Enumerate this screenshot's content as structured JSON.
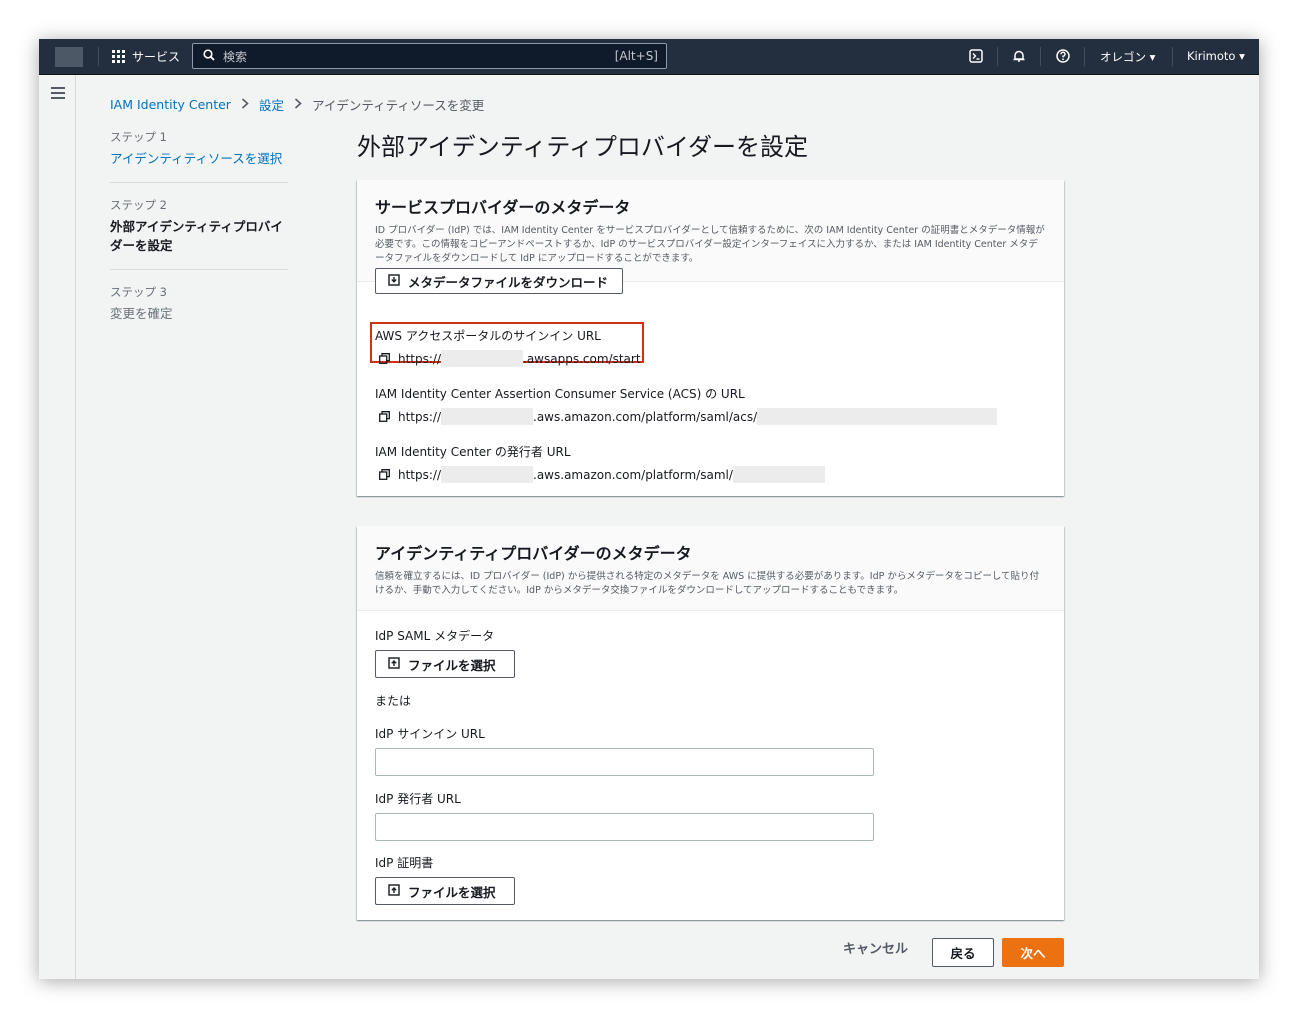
{
  "topnav": {
    "services_label": "サービス",
    "search_placeholder": "検索",
    "search_shortcut": "[Alt+S]",
    "region_label": "オレゴン ▾",
    "user_label": "Kirimoto ▾"
  },
  "breadcrumb": {
    "items": [
      "IAM Identity Center",
      "設定",
      "アイデンティティソースを変更"
    ]
  },
  "steps": [
    {
      "number": "ステップ 1",
      "title": "アイデンティティソースを選択"
    },
    {
      "number": "ステップ 2",
      "title": "外部アイデンティティプロバイダーを設定"
    },
    {
      "number": "ステップ 3",
      "title": "変更を確定"
    }
  ],
  "page_title": "外部アイデンティティプロバイダーを設定",
  "sp_panel": {
    "title": "サービスプロバイダーのメタデータ",
    "description": "ID プロバイダー (IdP) では、IAM Identity Center をサービスプロバイダーとして信頼するために、次の IAM Identity Center の証明書とメタデータ情報が必要です。この情報をコピーアンドペーストするか、IdP のサービスプロバイダー設定インターフェイスに入力するか、または IAM Identity Center メタデータファイルをダウンロードして IdP にアップロードすることができます。",
    "download_button": "メタデータファイルをダウンロード",
    "portal_label": "AWS アクセスポータルのサインイン URL",
    "portal_url_prefix": "https://",
    "portal_url_suffix": ".awsapps.com/start",
    "acs_label": "IAM Identity Center Assertion Consumer Service (ACS) の URL",
    "acs_url_prefix": "https://",
    "acs_url_middle": ".aws.amazon.com/platform/saml/acs/",
    "issuer_label": "IAM Identity Center の発行者 URL",
    "issuer_url_prefix": "https://",
    "issuer_url_middle": ".aws.amazon.com/platform/saml/"
  },
  "idp_panel": {
    "title": "アイデンティティプロバイダーのメタデータ",
    "description": "信頼を確立するには、ID プロバイダー (IdP) から提供される特定のメタデータを AWS に提供する必要があります。IdP からメタデータをコピーして貼り付けるか、手動で入力してください。IdP からメタデータ交換ファイルをダウンロードしてアップロードすることもできます。",
    "saml_label": "IdP SAML メタデータ",
    "choose_file_label": "ファイルを選択",
    "or_label": "または",
    "signin_url_label": "IdP サインイン URL",
    "signin_url_value": "",
    "issuer_url_label": "IdP 発行者 URL",
    "issuer_url_value": "",
    "cert_label": "IdP 証明書",
    "cert_choose_file_label": "ファイルを選択"
  },
  "footer": {
    "cancel": "キャンセル",
    "back": "戻る",
    "next": "次へ"
  },
  "colors": {
    "nav_bg": "#232f3e",
    "link": "#0073bb",
    "primary": "#ec7211",
    "highlight": "#d13212"
  }
}
